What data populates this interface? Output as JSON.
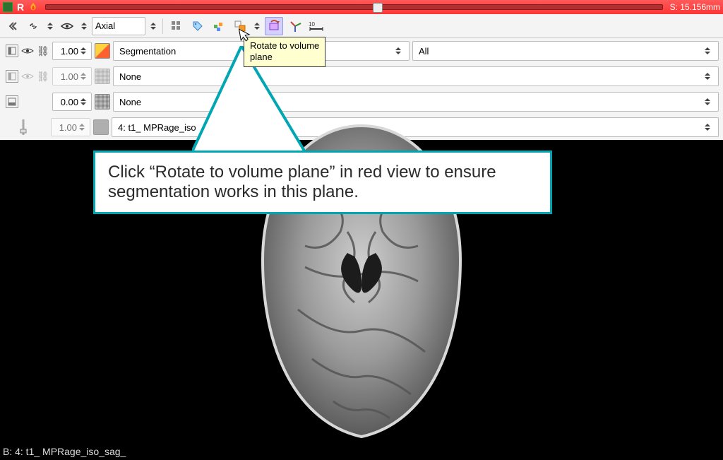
{
  "titlebar": {
    "slice_label_prefix": "S: ",
    "slice_value": "15.156mm",
    "view_letter": "R"
  },
  "toolbar": {
    "orientation": "Axial"
  },
  "layers": {
    "seg": {
      "opacity": "1.00",
      "dropdown1": "Segmentation",
      "dropdown2": "All"
    },
    "l1": {
      "opacity": "1.00",
      "dropdown": "None"
    },
    "l2": {
      "opacity": "0.00",
      "dropdown": "None"
    },
    "bg": {
      "opacity": "1.00",
      "dropdown": "4: t1_ MPRage_iso"
    }
  },
  "tooltip": {
    "line1": "Rotate to volume",
    "line2": "plane"
  },
  "callout": {
    "text": "Click “Rotate to volume plane” in red view to ensure segmentation works in this plane."
  },
  "status": {
    "text": "B: 4: t1_ MPRage_iso_sag_"
  }
}
